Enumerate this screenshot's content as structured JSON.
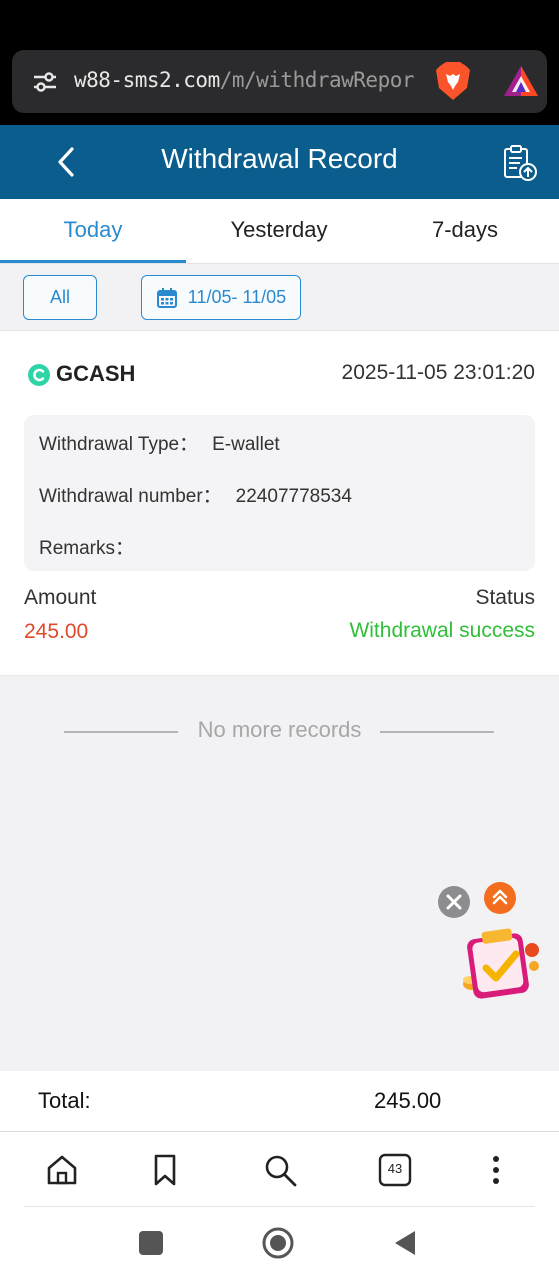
{
  "browser": {
    "url_host": "w88-sms2.com",
    "url_path": "/m/withdrawRepor",
    "tab_count": "43"
  },
  "header": {
    "title": "Withdrawal Record"
  },
  "tabs": [
    {
      "label": "Today",
      "active": true
    },
    {
      "label": "Yesterday",
      "active": false
    },
    {
      "label": "7-days",
      "active": false
    }
  ],
  "filters": {
    "all_label": "All",
    "date_range": "11/05- 11/05"
  },
  "record": {
    "method": "GCASH",
    "datetime": "2025-11-05 23:01:20",
    "type_label": "Withdrawal Type：",
    "type_value": "E-wallet",
    "number_label": "Withdrawal number：",
    "number_value": "22407778534",
    "remarks_label": "Remarks：",
    "remarks_value": "",
    "amount_label": "Amount",
    "amount_value": "245.00",
    "status_label": "Status",
    "status_value": "Withdrawal success"
  },
  "list_end_text": "No more records",
  "footer": {
    "total_label": "Total:",
    "total_value": "245.00"
  },
  "colors": {
    "header_bg": "#0a5d8c",
    "accent": "#2a8ad0",
    "amount": "#e0492a",
    "success": "#2fbf38"
  },
  "icons": {
    "url_bar_left": "tune-icon",
    "brave": "brave-lion-icon",
    "rewards": "brave-rewards-icon",
    "back": "chevron-left-icon",
    "export": "clipboard-upload-icon",
    "calendar": "calendar-icon",
    "gcash": "gcash-logo-icon",
    "close": "close-icon",
    "scroll_top": "double-chevron-up-icon",
    "promo": "gift-promo-icon",
    "home": "home-icon",
    "bookmark": "bookmark-icon",
    "search": "search-icon",
    "tabs": "tabs-icon",
    "menu": "more-vert-icon",
    "nav_recent": "square-icon",
    "nav_home": "circle-icon",
    "nav_back": "triangle-back-icon"
  }
}
